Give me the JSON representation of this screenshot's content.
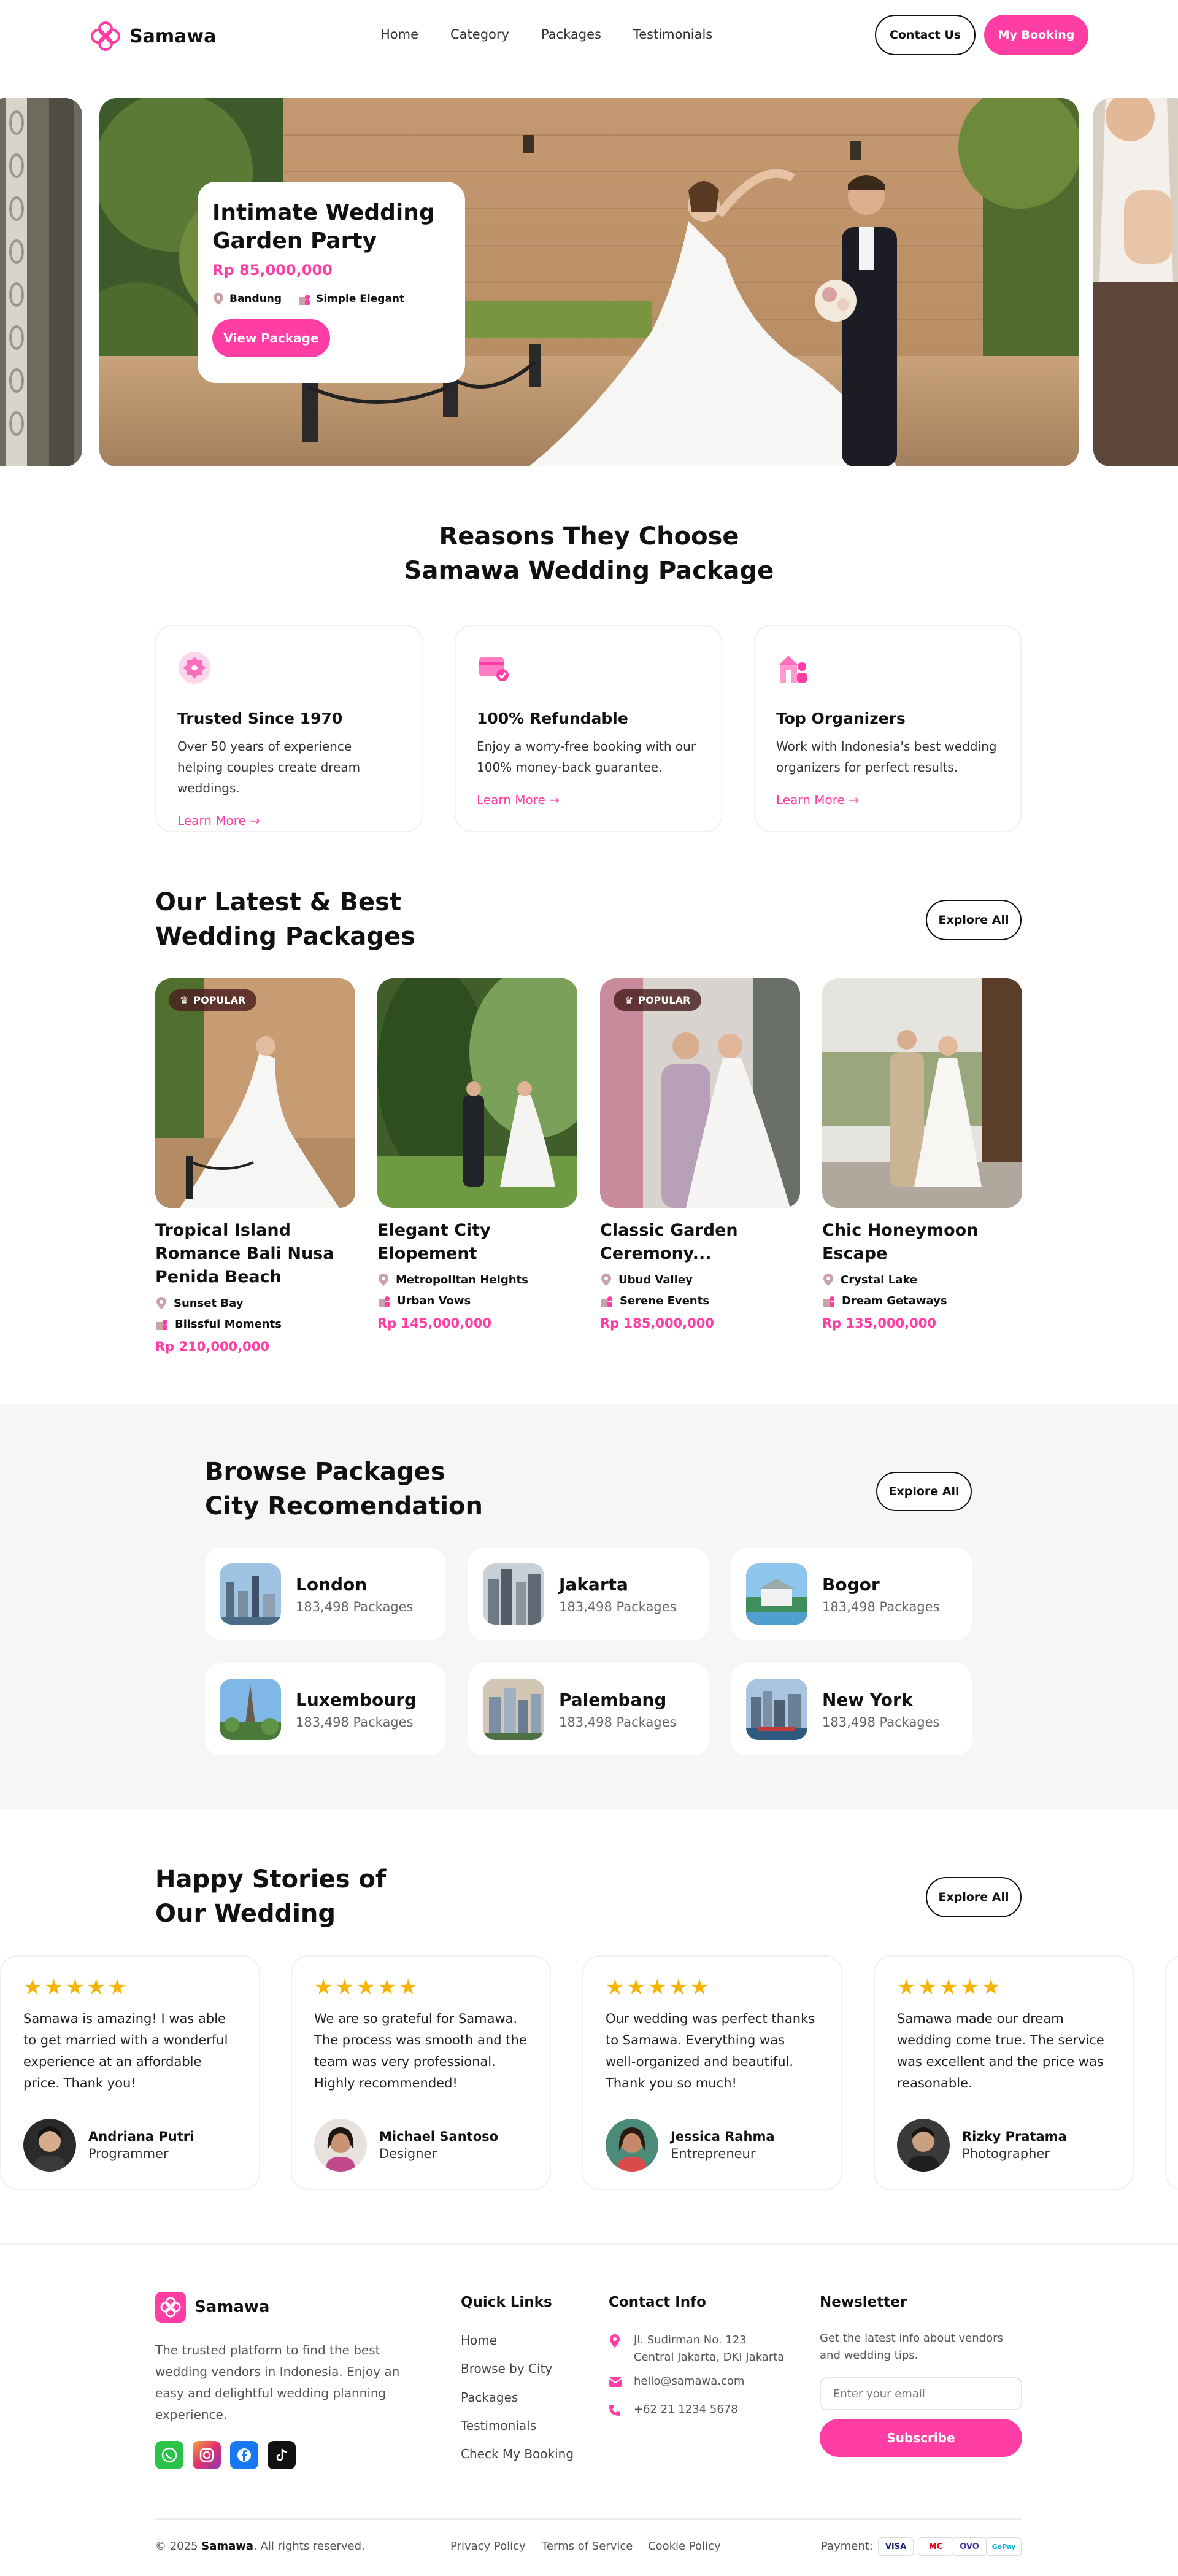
{
  "brand": {
    "name": "Samawa",
    "color": "#ff3ea5"
  },
  "nav": {
    "links": [
      "Home",
      "Category",
      "Packages",
      "Testimonials"
    ],
    "contact": "Contact Us",
    "booking": "My Booking"
  },
  "hero": {
    "title": "Intimate Wedding Garden Party",
    "price": "Rp 85,000,000",
    "location": "Bandung",
    "organizer": "Simple Elegant",
    "button": "View Package"
  },
  "reasons": {
    "title_line1": "Reasons They Choose",
    "title_line2": "Samawa Wedding Package",
    "items": [
      {
        "icon": "award-icon",
        "title": "Trusted Since 1970",
        "desc": "Over 50 years of experience helping couples create dream weddings.",
        "link": "Learn More →"
      },
      {
        "icon": "refund-card-icon",
        "title": "100% Refundable",
        "desc": "Enjoy a worry-free booking with our 100% money-back guarantee.",
        "link": "Learn More →"
      },
      {
        "icon": "organizer-icon",
        "title": "Top Organizers",
        "desc": "Work with Indonesia's best wedding organizers for perfect results.",
        "link": "Learn More →"
      }
    ]
  },
  "packages": {
    "title_line1": "Our Latest & Best",
    "title_line2": "Wedding Packages",
    "explore": "Explore All",
    "items": [
      {
        "badge": "POPULAR",
        "title": "Tropical Island Romance Bali Nusa Penida Beach",
        "location": "Sunset Bay",
        "organizer": "Blissful Moments",
        "price": "Rp 210,000,000"
      },
      {
        "badge": "",
        "title": "Elegant City Elopement",
        "location": "Metropolitan Heights",
        "organizer": "Urban Vows",
        "price": "Rp 145,000,000"
      },
      {
        "badge": "POPULAR",
        "title": "Classic Garden Ceremony...",
        "location": "Ubud Valley",
        "organizer": "Serene Events",
        "price": "Rp 185,000,000"
      },
      {
        "badge": "",
        "title": "Chic Honeymoon Escape",
        "location": "Crystal Lake",
        "organizer": "Dream Getaways",
        "price": "Rp 135,000,000"
      }
    ]
  },
  "cities": {
    "title_line1": "Browse Packages",
    "title_line2": "City Recomendation",
    "explore": "Explore All",
    "items": [
      {
        "name": "London",
        "count": "183,498 Packages"
      },
      {
        "name": "Jakarta",
        "count": "183,498 Packages"
      },
      {
        "name": "Bogor",
        "count": "183,498 Packages"
      },
      {
        "name": "Luxembourg",
        "count": "183,498 Packages"
      },
      {
        "name": "Palembang",
        "count": "183,498 Packages"
      },
      {
        "name": "New York",
        "count": "183,498 Packages"
      }
    ]
  },
  "stories": {
    "title_line1": "Happy Stories of",
    "title_line2": "Our Wedding",
    "explore": "Explore All",
    "items": [
      {
        "stars": "★★★★★",
        "text": "Samawa is amazing! I was able to get married with a wonderful experience at an affordable price. Thank you!",
        "name": "Andriana Putri",
        "role": "Programmer"
      },
      {
        "stars": "★★★★★",
        "text": "We are so grateful for Samawa. The process was smooth and the team was very professional. Highly recommended!",
        "name": "Michael Santoso",
        "role": "Designer"
      },
      {
        "stars": "★★★★★",
        "text": "Our wedding was perfect thanks to Samawa. Everything was well-organized and beautiful. Thank you so much!",
        "name": "Jessica Rahma",
        "role": "Entrepreneur"
      },
      {
        "stars": "★★★★★",
        "text": "Samawa made our dream wedding come true. The service was excellent and the price was reasonable.",
        "name": "Rizky Pratama",
        "role": "Photographer"
      }
    ]
  },
  "footer": {
    "about": "The trusted platform to find the best wedding vendors in Indonesia. Enjoy an easy and delightful wedding planning experience.",
    "quick_title": "Quick Links",
    "quick_links": [
      "Home",
      "Browse by City",
      "Packages",
      "Testimonials",
      "Check My Booking"
    ],
    "contact_title": "Contact Info",
    "address_line1": "Jl. Sudirman No. 123",
    "address_line2": "Central Jakarta, DKI Jakarta",
    "email": "hello@samawa.com",
    "phone": "+62 21 1234 5678",
    "news_title": "Newsletter",
    "news_desc": "Get the latest info about vendors and wedding tips.",
    "email_placeholder": "Enter your email",
    "subscribe": "Subscribe",
    "copyright_pre": "© 2025",
    "copyright_brand": "Samawa",
    "copyright_post": ". All rights reserved.",
    "legal": [
      "Privacy Policy",
      "Terms of Service",
      "Cookie Policy"
    ],
    "payment_label": "Payment:",
    "payments": [
      "VISA",
      "MC",
      "OVO",
      "GoPay"
    ]
  }
}
